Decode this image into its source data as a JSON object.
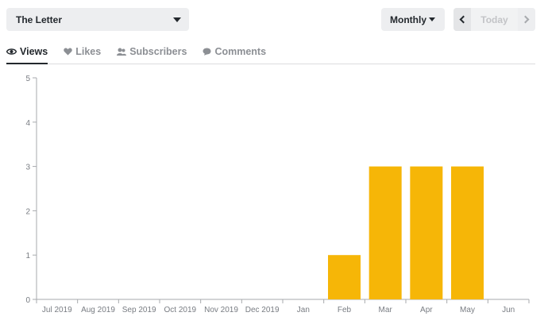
{
  "site_select": {
    "label": "The Letter"
  },
  "period_select": {
    "label": "Monthly"
  },
  "date_nav": {
    "today_label": "Today"
  },
  "tabs": [
    {
      "label": "Views",
      "icon": "eye-icon",
      "active": true
    },
    {
      "label": "Likes",
      "icon": "heart-icon",
      "active": false
    },
    {
      "label": "Subscribers",
      "icon": "subscribers-icon",
      "active": false
    },
    {
      "label": "Comments",
      "icon": "comment-icon",
      "active": false
    }
  ],
  "colors": {
    "bar": "#f6b607",
    "axis": "#a7aaad",
    "text_active": "#23282d",
    "text_muted": "#8c8f94"
  },
  "chart_data": {
    "type": "bar",
    "categories": [
      "Jul 2019",
      "Aug 2019",
      "Sep 2019",
      "Oct 2019",
      "Nov 2019",
      "Dec 2019",
      "Jan",
      "Feb",
      "Mar",
      "Apr",
      "May",
      "Jun"
    ],
    "values": [
      0,
      0,
      0,
      0,
      0,
      0,
      0,
      1,
      3,
      3,
      3,
      0
    ],
    "ylim": [
      0,
      5
    ],
    "yticks": [
      0,
      1,
      2,
      3,
      4,
      5
    ],
    "grid": false
  }
}
